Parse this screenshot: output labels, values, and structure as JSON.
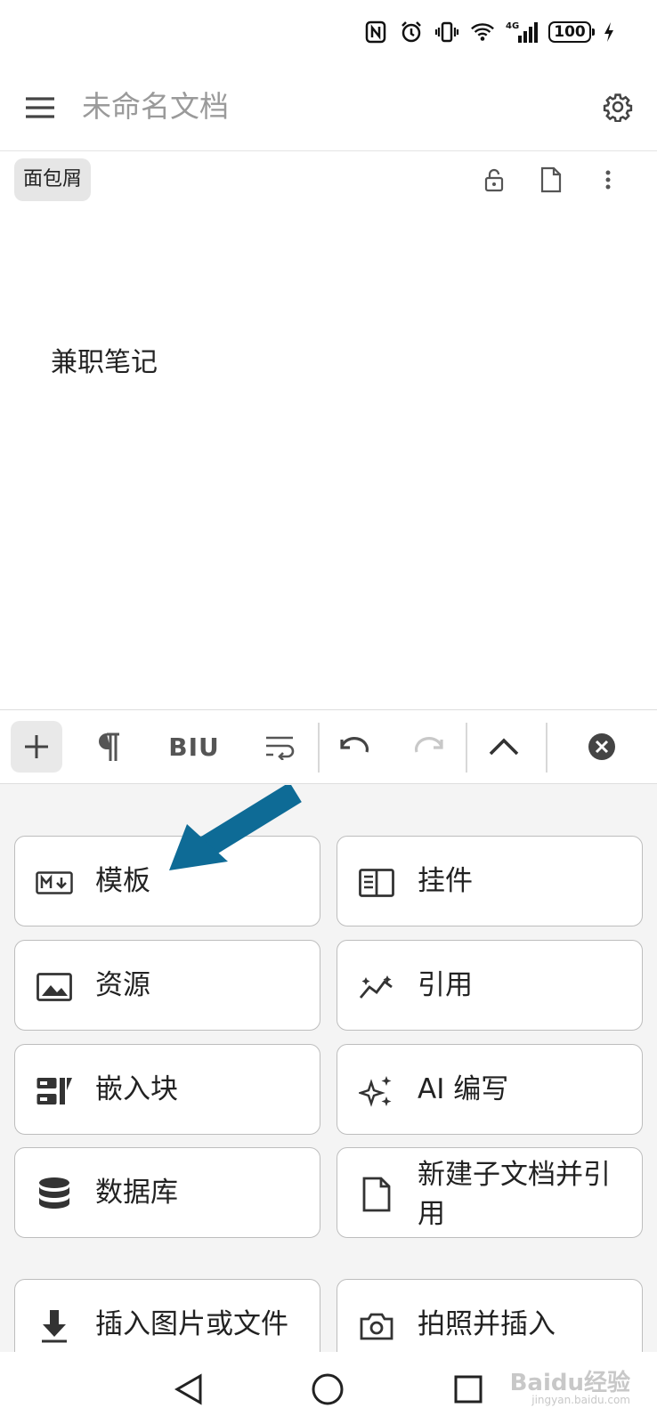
{
  "status_bar": {
    "battery": "100",
    "network": "4G",
    "icons": [
      "nfc-icon",
      "alarm-icon",
      "vibrate-icon",
      "wifi-icon",
      "signal-icon",
      "battery-icon",
      "charging-icon"
    ]
  },
  "header": {
    "title": "未命名文档",
    "icons": [
      "menu-icon",
      "gear-icon"
    ]
  },
  "breadcrumb": {
    "label": "面包屑",
    "icons": [
      "unlock-icon",
      "file-icon",
      "more-vertical-icon"
    ]
  },
  "editor": {
    "text": "兼职笔记"
  },
  "toolbar": {
    "format_label": "BIU",
    "icons": [
      "plus-icon",
      "paragraph-icon",
      "wrap-text-icon",
      "undo-icon",
      "redo-icon",
      "chevron-up-icon",
      "close-circle-icon"
    ]
  },
  "panel": {
    "items": [
      {
        "label": "模板",
        "icon": "markdown-icon"
      },
      {
        "label": "挂件",
        "icon": "widget-icon"
      },
      {
        "label": "资源",
        "icon": "image-icon"
      },
      {
        "label": "引用",
        "icon": "sparkline-icon"
      },
      {
        "label": "嵌入块",
        "icon": "embed-block-icon"
      },
      {
        "label": "AI 编写",
        "icon": "sparkle-icon"
      },
      {
        "label": "数据库",
        "icon": "database-icon"
      },
      {
        "label": "新建子文档并引用",
        "icon": "new-doc-icon"
      },
      {
        "label": "插入图片或文件",
        "icon": "download-icon"
      },
      {
        "label": "拍照并插入",
        "icon": "camera-icon"
      }
    ]
  },
  "nav_bar": {
    "icons": [
      "back-triangle-icon",
      "home-circle-icon",
      "recents-square-icon"
    ]
  },
  "watermark": {
    "text": "Baidu经验",
    "sub": "jingyan.baidu.com"
  },
  "colors": {
    "arrow": "#0e6b96",
    "panel_bg": "#f4f4f4",
    "title_gray": "#9a9a9a"
  }
}
